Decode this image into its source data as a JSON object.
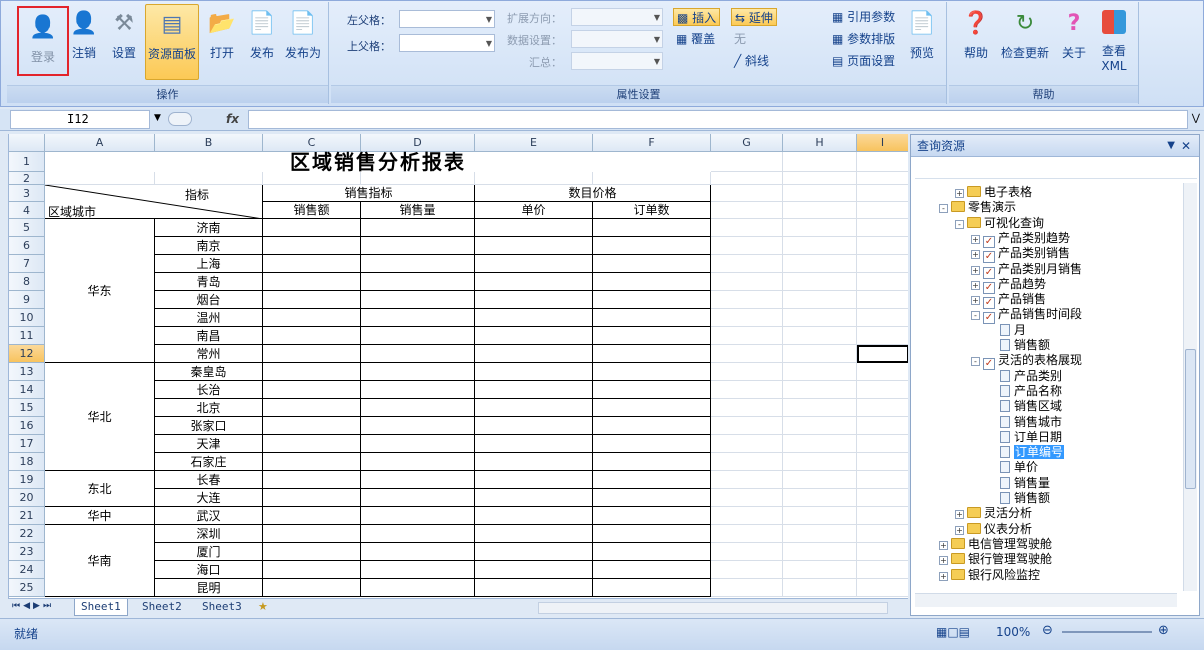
{
  "ribbon": {
    "group_ops_title": "操作",
    "group_props_title": "属性设置",
    "group_help_title": "帮助",
    "buttons": {
      "login": "登录",
      "logout": "注销",
      "settings": "设置",
      "resource_panel": "资源面板",
      "open": "打开",
      "publish": "发布",
      "publish_as": "发布为",
      "preview": "预览",
      "help": "帮助",
      "check_update": "检查更新",
      "about": "关于",
      "view_xml_1": "查看",
      "view_xml_2": "XML"
    },
    "props": {
      "left_parent": "左父格：",
      "top_parent": "上父格：",
      "expand_dir": "扩展方向：",
      "data_setting": "数据设置：",
      "summary": "汇总：",
      "insert": "插入",
      "cover": "覆盖",
      "extend": "延伸",
      "none": "无",
      "diagonal": "斜线",
      "ref_params": "引用参数",
      "param_layout": "参数排版",
      "page_setup": "页面设置"
    }
  },
  "formula_bar": {
    "cell_ref": "I12",
    "fx": "fx"
  },
  "sheet": {
    "columns": [
      "A",
      "B",
      "C",
      "D",
      "E",
      "F",
      "G",
      "H",
      "I"
    ],
    "rows": [
      "1",
      "2",
      "3",
      "4",
      "5",
      "6",
      "7",
      "8",
      "9",
      "10",
      "11",
      "12",
      "13",
      "14",
      "15",
      "16",
      "17",
      "18",
      "19",
      "20",
      "21",
      "22",
      "23",
      "24",
      "25"
    ],
    "title": "区域销售分析报表",
    "header_metric": "指标",
    "header_region": "区域城市",
    "header_sales_metric": "销售指标",
    "header_price": "数目价格",
    "col_sales_amount": "销售额",
    "col_sales_qty": "销售量",
    "col_unit_price": "单价",
    "col_orders": "订单数",
    "regions": [
      "华东",
      "华北",
      "东北",
      "华中",
      "华南"
    ],
    "cities": [
      "济南",
      "南京",
      "上海",
      "青岛",
      "烟台",
      "温州",
      "南昌",
      "常州",
      "秦皇岛",
      "长治",
      "北京",
      "张家口",
      "天津",
      "石家庄",
      "长春",
      "大连",
      "武汉",
      "深圳",
      "厦门",
      "海口",
      "昆明"
    ]
  },
  "tabs": [
    "Sheet1",
    "Sheet2",
    "Sheet3"
  ],
  "panel": {
    "title": "查询资源",
    "tree": [
      "电子表格",
      "零售演示",
      "可视化查询",
      "产品类别趋势",
      "产品类别销售",
      "产品类别月销售",
      "产品趋势",
      "产品销售",
      "产品销售时间段",
      "月",
      "销售额",
      "灵活的表格展现",
      "产品类别",
      "产品名称",
      "销售区域",
      "销售城市",
      "订单日期",
      "订单编号",
      "单价",
      "销售量",
      "销售额",
      "灵活分析",
      "仪表分析",
      "电信管理驾驶舱",
      "银行管理驾驶舱",
      "银行风险监控"
    ]
  },
  "status": {
    "ready": "就绪",
    "zoom": "100%"
  }
}
